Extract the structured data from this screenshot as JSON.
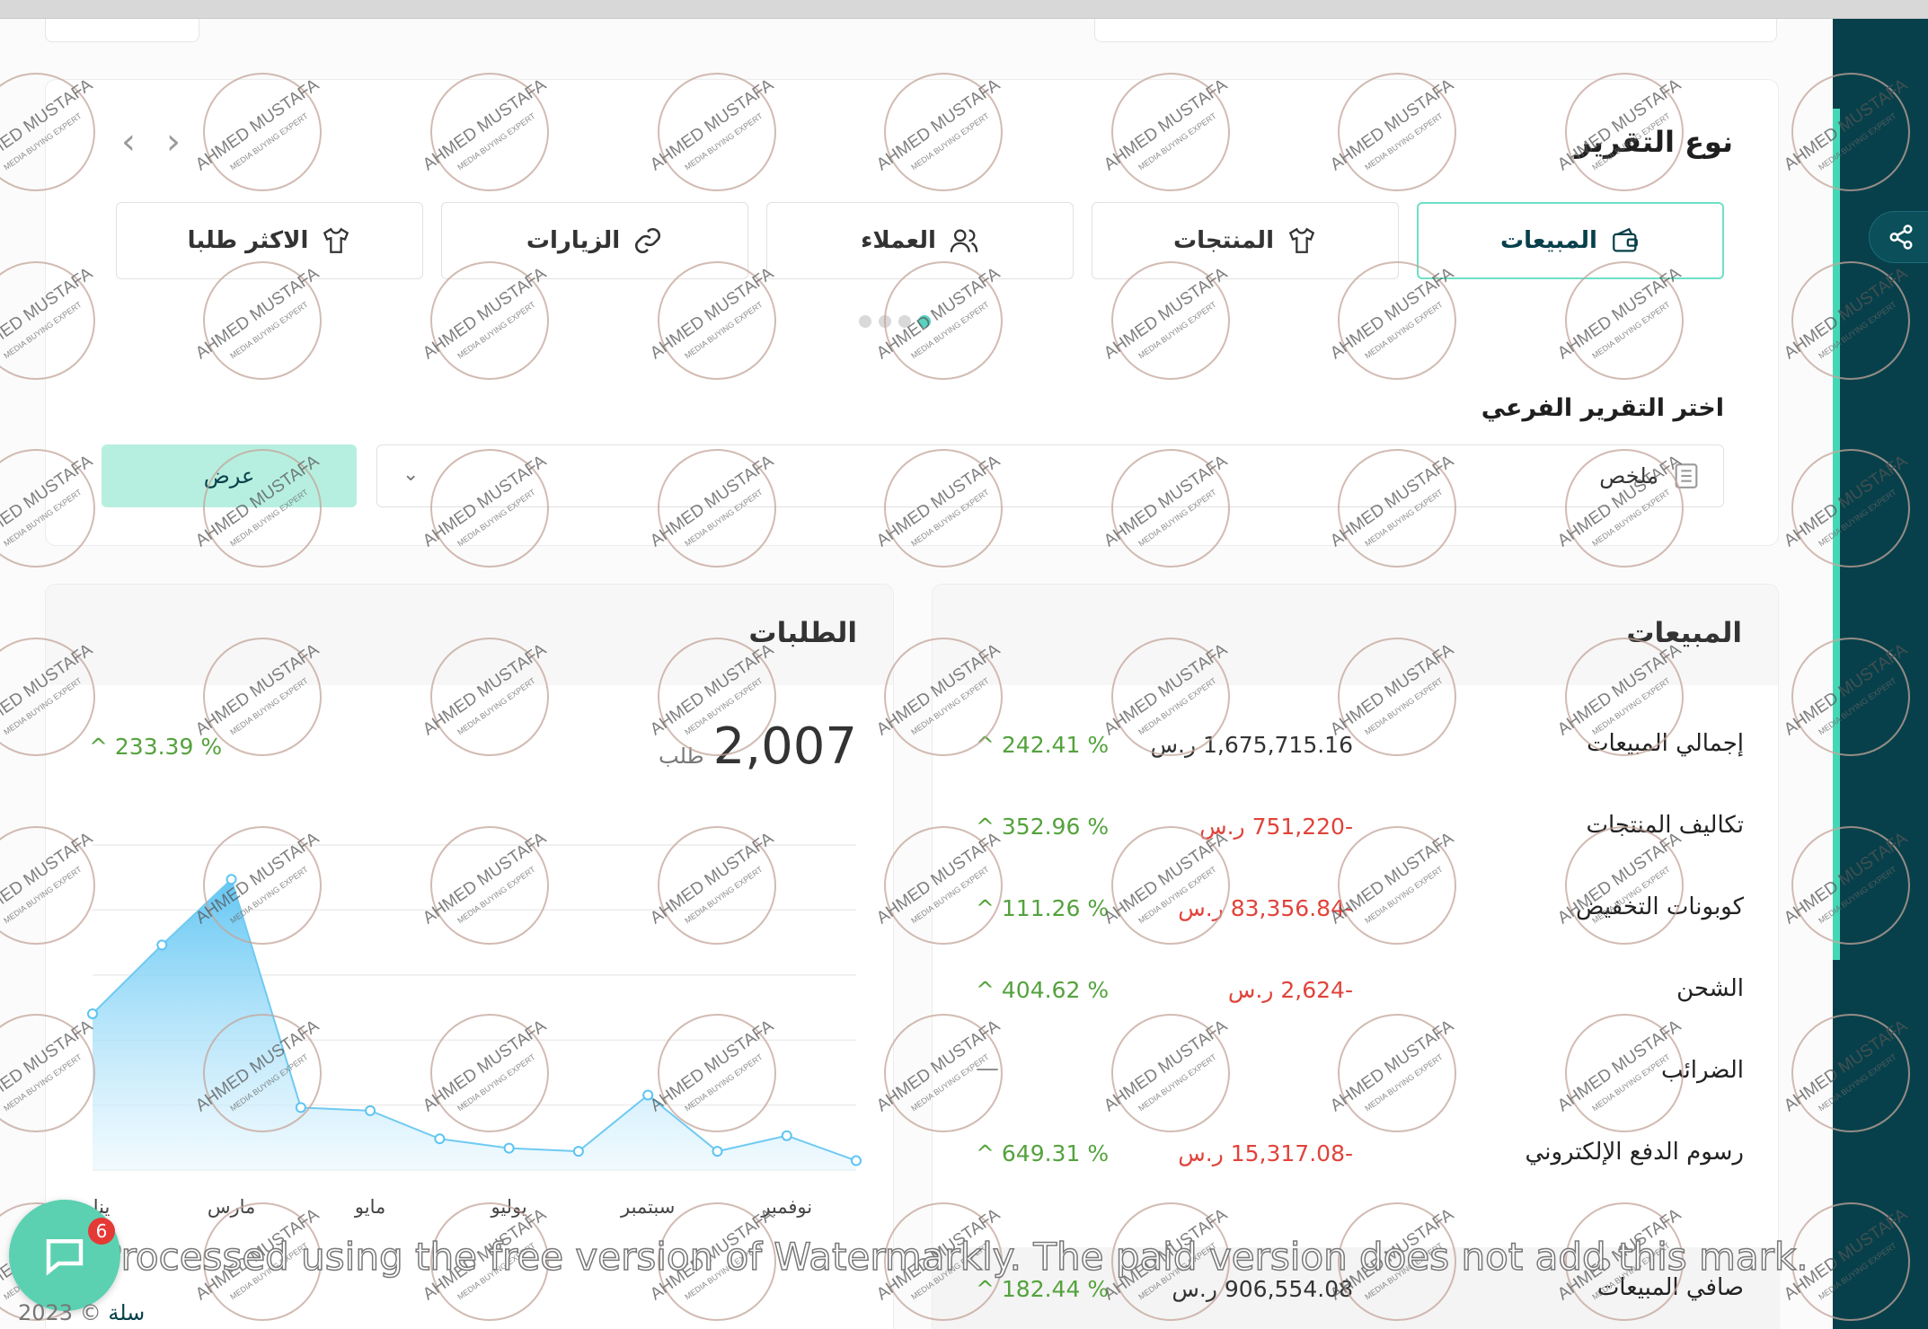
{
  "report": {
    "title": "نوع التقرير",
    "tabs": [
      {
        "label": "المبيعات",
        "icon": "wallet-icon",
        "active": true
      },
      {
        "label": "المنتجات",
        "icon": "shirt-icon",
        "active": false
      },
      {
        "label": "العملاء",
        "icon": "users-icon",
        "active": false
      },
      {
        "label": "الزيارات",
        "icon": "link-icon",
        "active": false
      },
      {
        "label": "الاكثر طلبا",
        "icon": "shirt-icon",
        "active": false
      }
    ],
    "sub_label": "اختر التقرير الفرعي",
    "sub_value": "ملخص",
    "show_button": "عرض"
  },
  "sales": {
    "title": "المبيعات",
    "rows": [
      {
        "label": "إجمالي المبيعات",
        "value": "1,675,715.16 ر.س",
        "negative": false,
        "pct": "^ 242.41 %"
      },
      {
        "label": "تكاليف المنتجات",
        "value": "-751,220 ر.س",
        "negative": true,
        "pct": "^ 352.96 %"
      },
      {
        "label": "كوبونات التخفيض",
        "value": "-83,356.84 ر.س",
        "negative": true,
        "pct": "^ 111.26 %"
      },
      {
        "label": "الشحن",
        "value": "-2,624 ر.س",
        "negative": true,
        "pct": "^ 404.62 %"
      },
      {
        "label": "الضرائب",
        "value": "",
        "negative": false,
        "pct": "",
        "dash": "—"
      },
      {
        "label": "رسوم الدفع الإلكتروني",
        "value": "-15,317.08 ر.س",
        "negative": true,
        "pct": "^ 649.31 %"
      }
    ],
    "net": {
      "label": "صافي المبيعات",
      "value": "906,554.08 ر.س",
      "pct": "^ 182.44 %"
    }
  },
  "orders": {
    "title": "الطلبات",
    "total": "2,007",
    "unit": "طلب",
    "pct": "^ 233.39 %"
  },
  "chart_data": {
    "type": "area",
    "x_tick_labels": [
      "ينا",
      "مارس",
      "مايو",
      "يوليو",
      "سبتمبر",
      "نوفمبر"
    ],
    "values": [
      250,
      360,
      465,
      100,
      95,
      50,
      35,
      30,
      120,
      30,
      55,
      15
    ],
    "ylim": [
      0,
      520
    ],
    "grid": true,
    "color": "#7fd3f7"
  },
  "watermark": {
    "text": "Processed using the free version of Watermarkly. The paid version does not add this mark.",
    "stamp_top": "AHMED MUSTAFA",
    "stamp_bottom": "MEDIA BUYING EXPERT"
  },
  "footer": {
    "copyright": "2023 © ",
    "brand": "سلة"
  },
  "chat": {
    "badge": "6"
  },
  "colors": {
    "brand_dark": "#07404a",
    "brand_accent": "#44d7b6",
    "positive": "#54a23d",
    "negative": "#e0433b"
  }
}
